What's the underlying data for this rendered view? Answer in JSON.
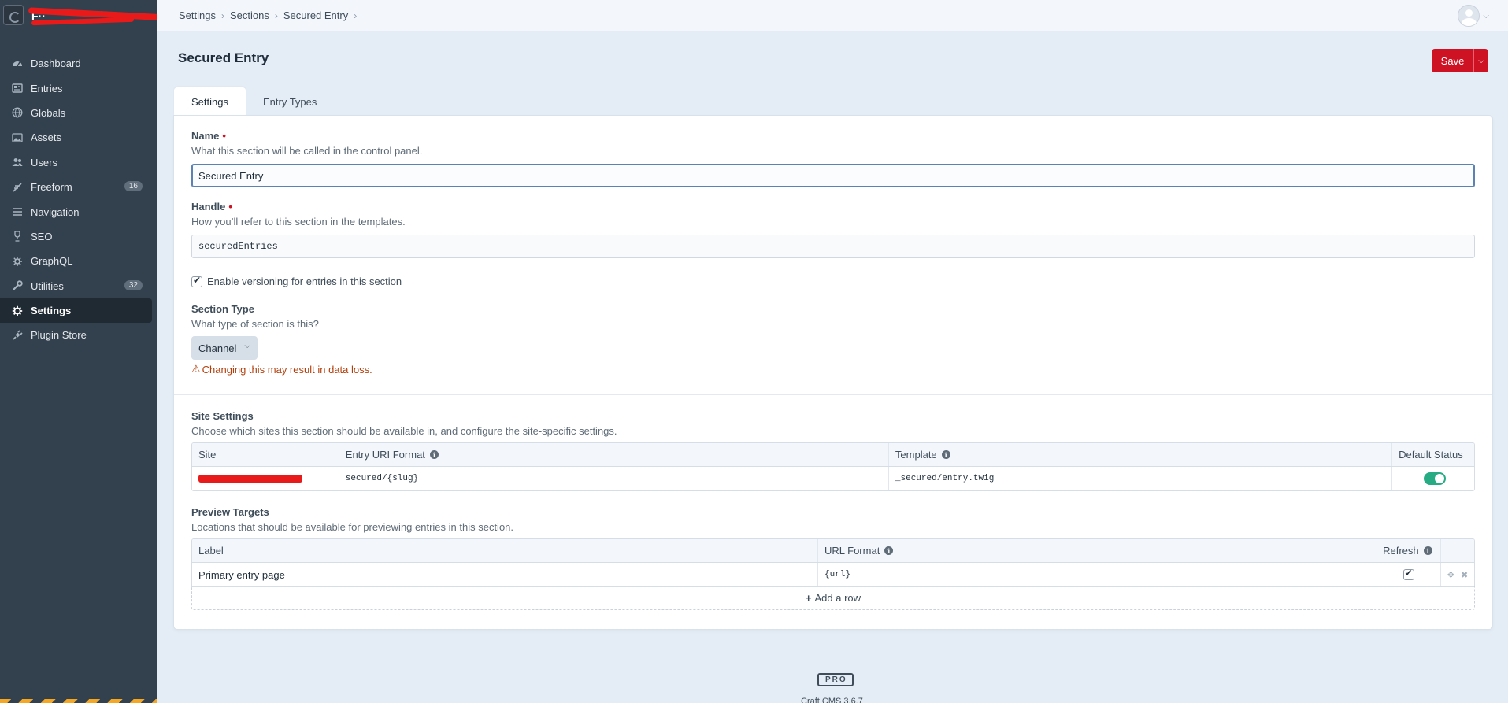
{
  "sidebar": {
    "site_name": "F··",
    "items": [
      {
        "label": "Dashboard",
        "icon": "gauge-icon"
      },
      {
        "label": "Entries",
        "icon": "newspaper-icon"
      },
      {
        "label": "Globals",
        "icon": "globe-icon"
      },
      {
        "label": "Assets",
        "icon": "image-icon"
      },
      {
        "label": "Users",
        "icon": "users-icon"
      },
      {
        "label": "Freeform",
        "icon": "freeform-icon",
        "badge": "16"
      },
      {
        "label": "Navigation",
        "icon": "list-icon"
      },
      {
        "label": "SEO",
        "icon": "trophy-icon"
      },
      {
        "label": "GraphQL",
        "icon": "graphql-icon"
      },
      {
        "label": "Utilities",
        "icon": "wrench-icon",
        "badge": "32"
      },
      {
        "label": "Settings",
        "icon": "gear-icon",
        "active": true
      },
      {
        "label": "Plugin Store",
        "icon": "plug-icon"
      }
    ]
  },
  "header": {
    "breadcrumbs": [
      "Settings",
      "Sections",
      "Secured Entry"
    ]
  },
  "page": {
    "title": "Secured Entry",
    "save_label": "Save",
    "tabs": [
      "Settings",
      "Entry Types"
    ]
  },
  "form": {
    "name": {
      "label": "Name",
      "instructions": "What this section will be called in the control panel.",
      "value": "Secured Entry"
    },
    "handle": {
      "label": "Handle",
      "instructions": "How you’ll refer to this section in the templates.",
      "value": "securedEntries"
    },
    "versioning_label": "Enable versioning for entries in this section",
    "section_type": {
      "label": "Section Type",
      "instructions": "What type of section is this?",
      "value": "Channel",
      "warning": "Changing this may result in data loss."
    },
    "site_settings": {
      "label": "Site Settings",
      "instructions": "Choose which sites this section should be available in, and configure the site-specific settings.",
      "columns": [
        "Site",
        "Entry URI Format",
        "Template",
        "Default Status"
      ],
      "rows": [
        {
          "uri_format": "secured/{slug}",
          "template": "_secured/entry.twig",
          "default_status": "enabled"
        }
      ]
    },
    "preview_targets": {
      "label": "Preview Targets",
      "instructions": "Locations that should be available for previewing entries in this section.",
      "columns": [
        "Label",
        "URL Format",
        "Refresh"
      ],
      "rows": [
        {
          "label": "Primary entry page",
          "url_format": "{url}",
          "refresh": true
        }
      ],
      "add_row_label": "Add a row"
    }
  },
  "footer": {
    "edition": "PRO",
    "version": "Craft CMS 3.6.7"
  },
  "colors": {
    "sidebar_bg": "#33404d",
    "save_red": "#cf1124",
    "toggle_green": "#27ab83",
    "warning": "#b23e0b"
  }
}
